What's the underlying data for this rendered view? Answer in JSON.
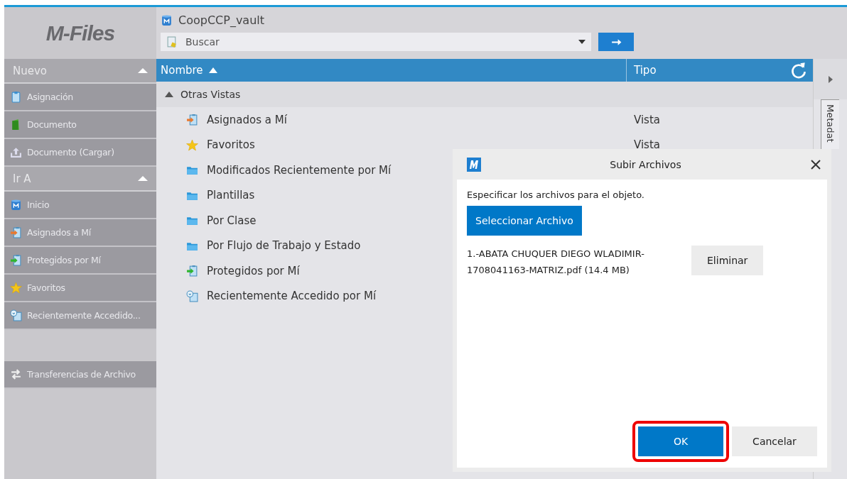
{
  "logo": "M-Files",
  "vault": {
    "title": "CoopCCP_vault"
  },
  "search": {
    "placeholder": "Buscar"
  },
  "sidebar": {
    "sections": [
      {
        "title": "Nuevo",
        "expanded": true,
        "items": [
          {
            "label": "Asignación",
            "kind": "clipboard"
          },
          {
            "label": "Documento",
            "kind": "document"
          },
          {
            "label": "Documento (Cargar)",
            "kind": "upload"
          }
        ]
      },
      {
        "title": "Ir A",
        "expanded": true,
        "items": [
          {
            "label": "Inicio",
            "kind": "vault"
          },
          {
            "label": "Asignados a Mí",
            "kind": "assigned"
          },
          {
            "label": "Protegidos por Mí",
            "kind": "checked-out"
          },
          {
            "label": "Favoritos",
            "kind": "star"
          },
          {
            "label": "Recientemente Accedido...",
            "kind": "recent"
          }
        ]
      }
    ],
    "footer": {
      "label": "Transferencias de Archivo",
      "kind": "transfer"
    }
  },
  "table": {
    "columns": [
      {
        "label": "Nombre",
        "sorted": true
      },
      {
        "label": "Tipo",
        "sorted": false
      }
    ],
    "groups": [
      {
        "label": "Otras Vistas",
        "expanded": true,
        "children": [
          {
            "name": "Asignados a Mí",
            "tipo": "Vista",
            "kind": "assigned"
          },
          {
            "name": "Favoritos",
            "tipo": "Vista",
            "kind": "star"
          },
          {
            "name": "Modificados Recientemente por Mí",
            "kind": "folder"
          },
          {
            "name": "Plantillas",
            "kind": "folder"
          },
          {
            "name": "Por Clase",
            "kind": "folder"
          },
          {
            "name": "Por Flujo de Trabajo y Estado",
            "kind": "folder"
          },
          {
            "name": "Protegidos por Mí",
            "kind": "checked-out"
          },
          {
            "name": "Recientemente Accedido por Mí",
            "kind": "recent"
          }
        ]
      }
    ]
  },
  "right_panel": {
    "tab": "Metadat"
  },
  "dialog": {
    "title": "Subir Archivos",
    "instruction": "Especificar los archivos para el objeto.",
    "select_button": "Seleccionar Archivo",
    "files": [
      {
        "name": "1.-ABATA CHUQUER DIEGO WLADIMIR-1708041163-MATRIZ.pdf (14.4 MB)",
        "remove": "Eliminar"
      }
    ],
    "buttons": [
      {
        "label": "OK",
        "kind": "primary",
        "highlighted": true
      },
      {
        "label": "Cancelar",
        "kind": "secondary",
        "highlighted": false
      }
    ]
  }
}
